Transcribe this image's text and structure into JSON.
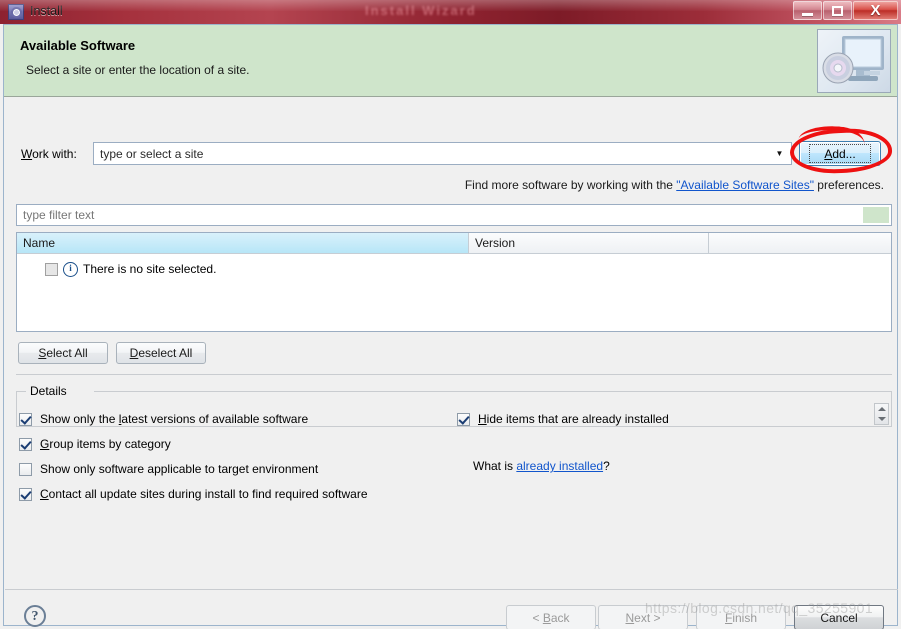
{
  "window": {
    "title": "Install",
    "title_icon": "gear-icon",
    "ghost_title": "Install Wizard",
    "controls": {
      "minimize": "minimize-icon",
      "maximize": "maximize-icon",
      "close": "X"
    }
  },
  "banner": {
    "title": "Available Software",
    "subtitle": "Select a site or enter the location of a site.",
    "icon": "computer-disc-icon"
  },
  "work_with": {
    "label_pre": "W",
    "label_post": "ork with:",
    "value": "type or select a site",
    "dropdown_icon": "chevron-down-icon",
    "add_button_pre": "A",
    "add_button_post": "dd...",
    "annotation": "red-circle-highlight"
  },
  "find_more": {
    "prefix": "Find more software by working with the ",
    "link": "\"Available Software Sites\"",
    "suffix": " preferences."
  },
  "filter": {
    "placeholder": "type filter text",
    "value": ""
  },
  "table": {
    "columns": [
      "Name",
      "Version",
      ""
    ],
    "sorted_column": "Name",
    "rows": [
      {
        "checkbox": "unchecked",
        "icon": "info-icon",
        "name": "There is no site selected.",
        "version": ""
      }
    ]
  },
  "buttons": {
    "select_all_pre": "S",
    "select_all_post": "elect All",
    "deselect_all_pre": "D",
    "deselect_all_post": "eselect All"
  },
  "details": {
    "legend": "Details",
    "content": "",
    "spinner_up": "scroll-up-icon",
    "spinner_down": "scroll-down-icon"
  },
  "options": {
    "left": [
      {
        "checked": true,
        "pre": "Show only the ",
        "mnemonic": "l",
        "post": "atest versions of available software"
      },
      {
        "checked": true,
        "pre": "",
        "mnemonic": "G",
        "post": "roup items by category"
      },
      {
        "checked": false,
        "pre": "",
        "mnemonic": "S",
        "post": "how only software applicable to target environment"
      },
      {
        "checked": true,
        "pre": "",
        "mnemonic": "C",
        "post": "ontact all update sites during install to find required software"
      }
    ],
    "right": [
      {
        "checked": true,
        "pre": "",
        "mnemonic": "H",
        "post": "ide items that are already installed"
      }
    ],
    "what_is_prefix": "What is ",
    "what_is_link": "already installed",
    "what_is_suffix": "?"
  },
  "footer": {
    "help_icon": "?",
    "back_pre": "< ",
    "back_mnemonic": "B",
    "back_post": "ack",
    "next_pre": "",
    "next_mnemonic": "N",
    "next_post": "ext >",
    "finish_mnemonic": "F",
    "finish_post": "inish",
    "cancel": "Cancel"
  },
  "watermark": "https://blog.csdn.net/qq_35255901",
  "colors": {
    "titlebar": "#8f2330",
    "banner": "#cfe5cb",
    "accent_link": "#1155cc",
    "annotation": "#ee1111",
    "sorted_header": "#b7e6f7"
  }
}
